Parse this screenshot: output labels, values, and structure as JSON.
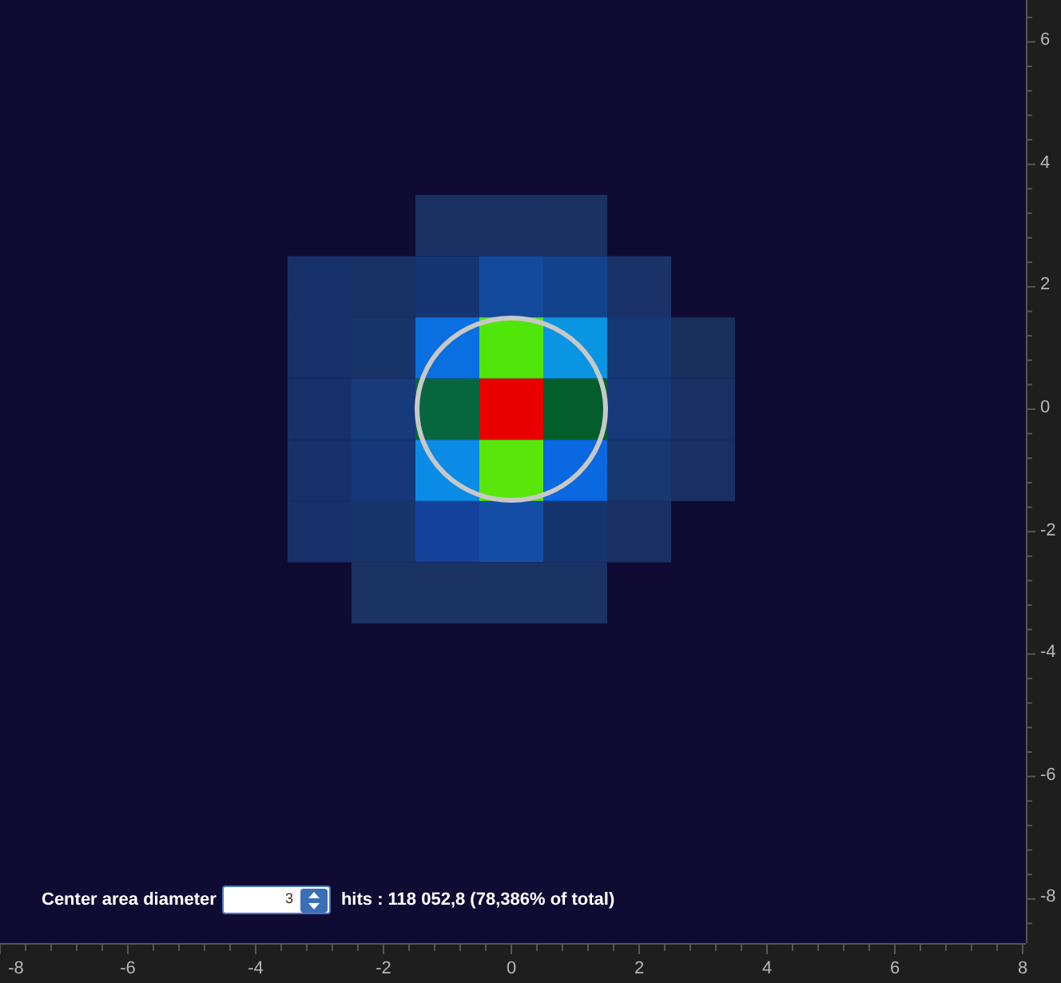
{
  "center_area": {
    "label": "Center area diameter",
    "value": "3",
    "result": "hits : 118 052,8 (78,386% of total)"
  },
  "x_axis": {
    "ticks": [
      "-8",
      "-6",
      "-4",
      "-2",
      "0",
      "2",
      "4",
      "6",
      "8"
    ]
  },
  "y_axis": {
    "ticks": [
      "6",
      "4",
      "2",
      "0",
      "-2",
      "-4",
      "-6",
      "-8"
    ]
  }
}
